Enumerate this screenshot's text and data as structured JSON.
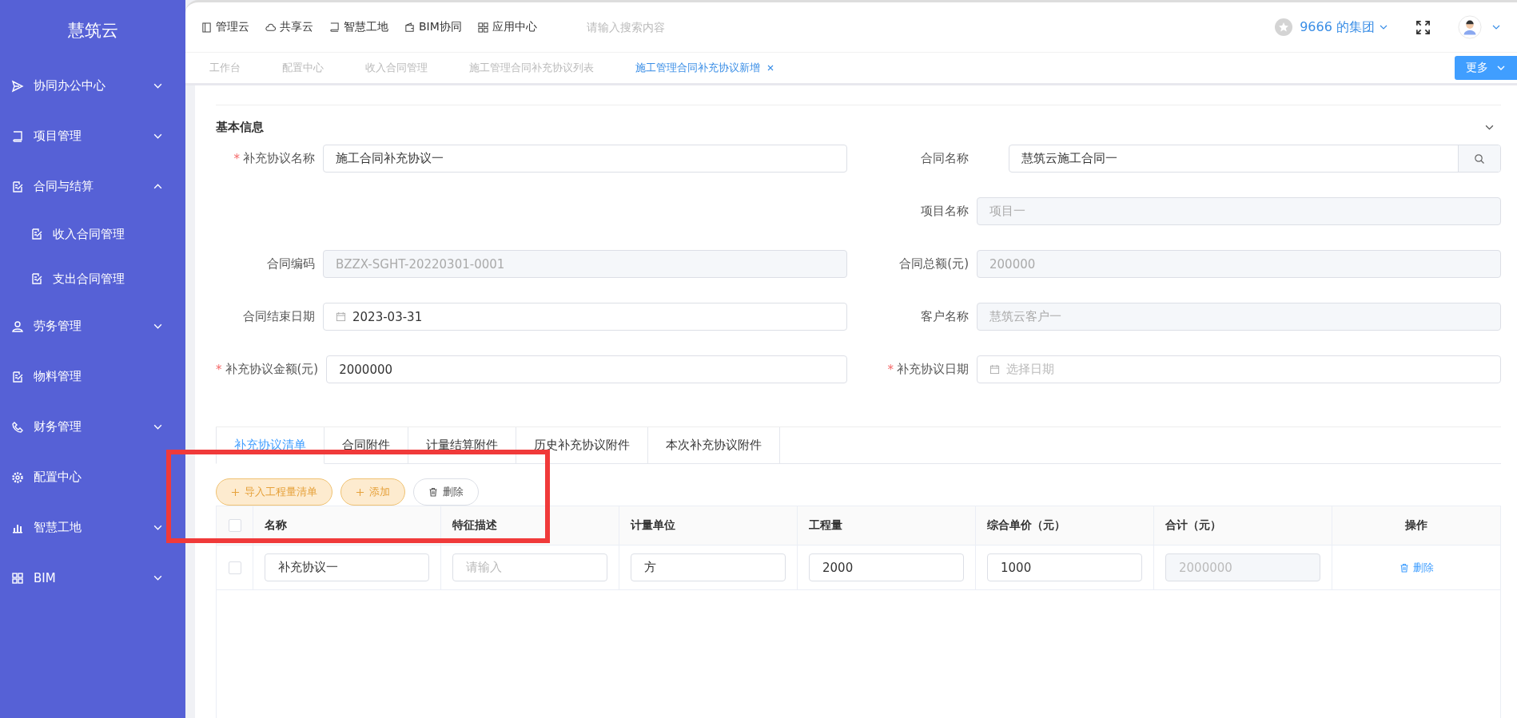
{
  "sidebar": {
    "logo": "慧筑云",
    "items": [
      {
        "label": "协同办公中心",
        "expanded": false
      },
      {
        "label": "项目管理",
        "expanded": false
      },
      {
        "label": "合同与结算",
        "expanded": true,
        "children": [
          {
            "label": "收入合同管理"
          },
          {
            "label": "支出合同管理"
          }
        ]
      },
      {
        "label": "劳务管理",
        "expanded": false
      },
      {
        "label": "物料管理"
      },
      {
        "label": "财务管理",
        "expanded": false
      },
      {
        "label": "配置中心"
      },
      {
        "label": "智慧工地",
        "expanded": false
      },
      {
        "label": "BIM",
        "expanded": false
      }
    ]
  },
  "topnav": [
    {
      "label": "管理云"
    },
    {
      "label": "共享云"
    },
    {
      "label": "智慧工地"
    },
    {
      "label": "BIM协同"
    },
    {
      "label": "应用中心"
    }
  ],
  "search": {
    "placeholder": "请输入搜索内容"
  },
  "org": {
    "name": "9666 的集团"
  },
  "page_tabs": [
    {
      "label": "工作台",
      "selected": false
    },
    {
      "label": "配置中心",
      "selected": false
    },
    {
      "label": "收入合同管理",
      "selected": false
    },
    {
      "label": "施工管理合同补充协议列表",
      "selected": false
    },
    {
      "label": "施工管理合同补充协议新增",
      "selected": true,
      "closable": true
    }
  ],
  "more_button": "更多",
  "section": {
    "title": "基本信息",
    "expanded": true
  },
  "form_rows": [
    {
      "left": {
        "required_mark": "*",
        "label": "补充协议名称",
        "kind": "text",
        "value": "施工合同补充协议一",
        "disabled": false
      },
      "right": {
        "label": "合同名称",
        "kind": "search",
        "value": "慧筑云施工合同一",
        "disabled": false
      }
    },
    {
      "right": {
        "label": "项目名称",
        "kind": "text",
        "value": "项目一",
        "disabled": true
      }
    },
    {
      "left": {
        "label": "合同编码",
        "kind": "text",
        "value": "BZZX-SGHT-20220301-0001",
        "disabled": true
      },
      "right": {
        "label": "合同总额(元)",
        "kind": "text",
        "value": "200000",
        "disabled": true
      }
    },
    {
      "left": {
        "label": "合同结束日期",
        "kind": "date",
        "value": "2023-03-31",
        "disabled": false
      },
      "right": {
        "label": "客户名称",
        "kind": "text",
        "value": "慧筑云客户一",
        "disabled": true
      }
    },
    {
      "left": {
        "required_mark": "*",
        "label": "补充协议金额(元)",
        "kind": "text",
        "value": "2000000",
        "disabled": false
      },
      "right": {
        "required_mark": "*",
        "label": "补充协议日期",
        "kind": "date",
        "placeholder": "选择日期",
        "disabled": false
      }
    }
  ],
  "detail_tabs": [
    {
      "label": "补充协议清单",
      "selected": true
    },
    {
      "label": "合同附件",
      "selected": false
    },
    {
      "label": "计量结算附件",
      "selected": false
    },
    {
      "label": "历史补充协议附件",
      "selected": false
    },
    {
      "label": "本次补充协议附件",
      "selected": false
    }
  ],
  "actions": [
    {
      "label": "导入工程量清单",
      "kind": "add"
    },
    {
      "label": "添加",
      "kind": "add"
    },
    {
      "label": "删除",
      "kind": "delete"
    }
  ],
  "table": {
    "header_checked": false,
    "columns": [
      "名称",
      "特征描述",
      "计量单位",
      "工程量",
      "综合单价（元）",
      "合计（元）",
      "操作"
    ],
    "rows": [
      {
        "checked": false,
        "cells": [
          {
            "kind": "input",
            "value": "补充协议一"
          },
          {
            "kind": "input",
            "placeholder": "请输入"
          },
          {
            "kind": "input",
            "value": "方"
          },
          {
            "kind": "input",
            "value": "2000"
          },
          {
            "kind": "input",
            "value": "1000"
          },
          {
            "kind": "disabled",
            "value": "2000000"
          },
          {
            "kind": "link",
            "value": "删除"
          }
        ]
      }
    ]
  }
}
